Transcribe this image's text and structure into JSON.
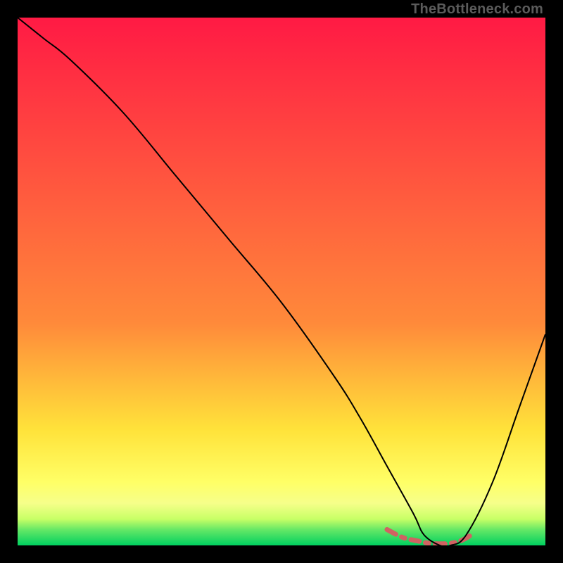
{
  "watermark": "TheBottleneck.com",
  "colors": {
    "highlight": "#d06262",
    "curve": "#000000",
    "gradient": {
      "top": "#ff1a44",
      "t58": "#ff8a3a",
      "t78": "#ffe23a",
      "t88": "#ffff66",
      "t92": "#f6ff8a",
      "t95": "#c8ff66",
      "t97": "#66e866",
      "bottom": "#00d060"
    }
  },
  "chart_data": {
    "type": "line",
    "title": "",
    "xlabel": "",
    "ylabel": "",
    "xlim": [
      0,
      100
    ],
    "ylim": [
      0,
      100
    ],
    "grid": false,
    "legend": false,
    "annotations": [
      "TheBottleneck.com"
    ],
    "series": [
      {
        "name": "bottleneck-curve",
        "x": [
          0,
          5,
          10,
          20,
          30,
          40,
          50,
          60,
          65,
          70,
          75,
          77,
          80,
          82,
          85,
          90,
          95,
          100
        ],
        "y": [
          100,
          96,
          92,
          82,
          70,
          58,
          46,
          32,
          24,
          15,
          6,
          2,
          0,
          0,
          2,
          12,
          26,
          40
        ]
      },
      {
        "name": "optimal-range-highlight",
        "x": [
          70,
          73,
          76,
          78,
          80,
          82,
          84,
          86
        ],
        "y": [
          3,
          1.5,
          0.8,
          0.4,
          0.3,
          0.4,
          0.9,
          2
        ]
      }
    ]
  }
}
